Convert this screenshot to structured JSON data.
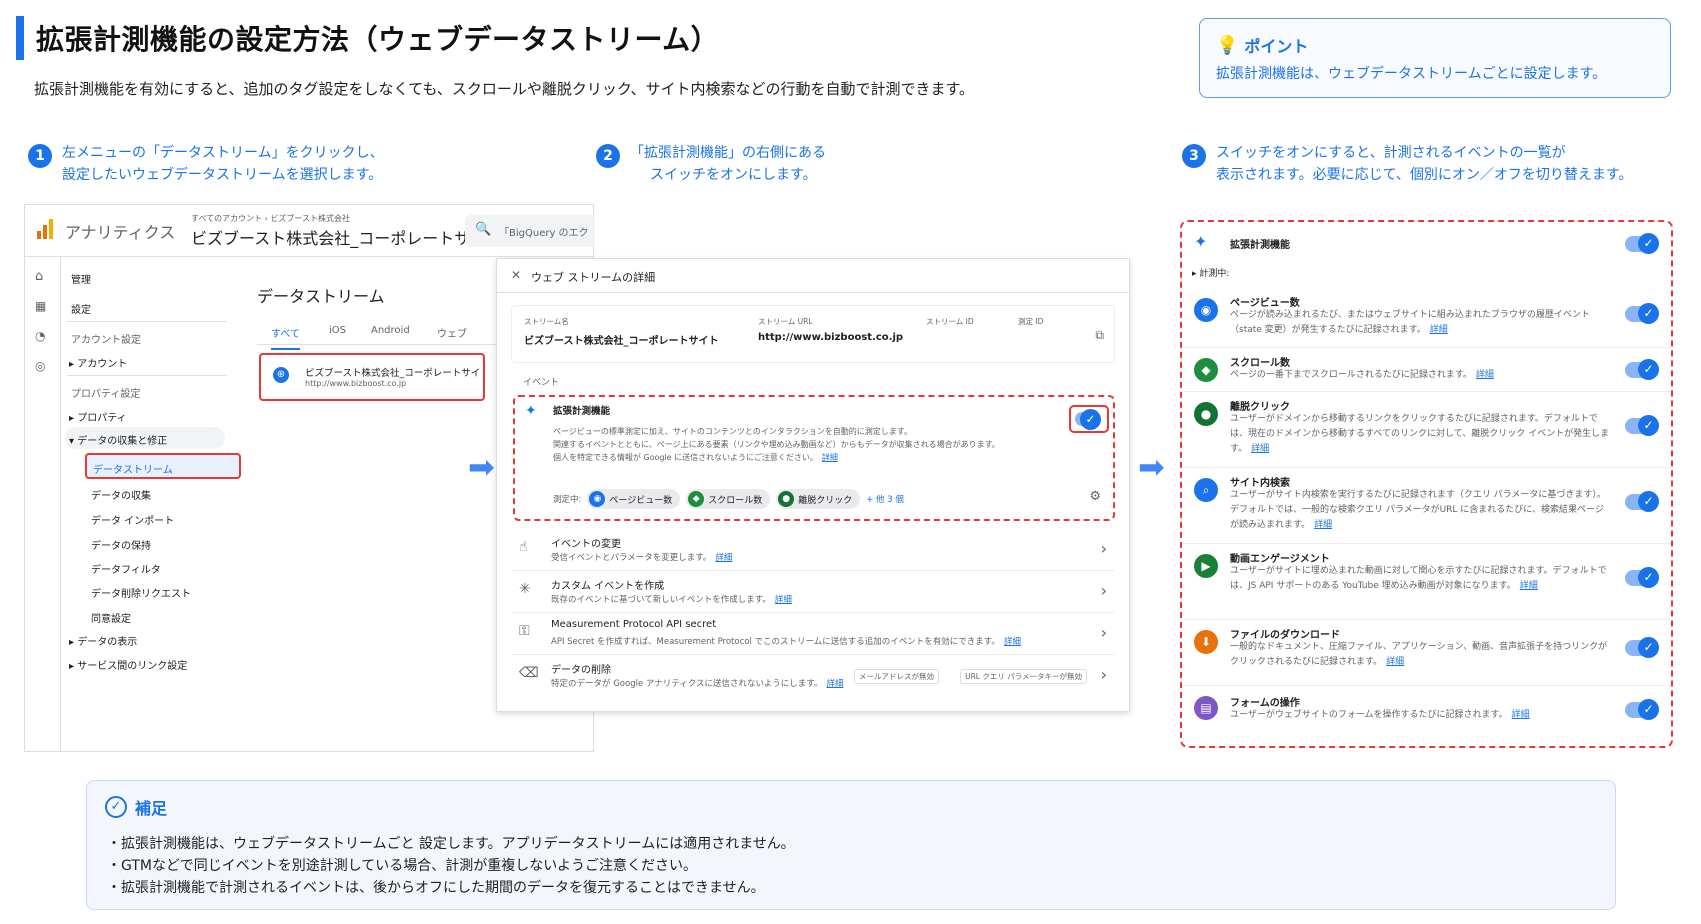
{
  "header": {
    "title": "拡張計測機能の設定方法（ウェブデータストリーム）",
    "subtitle": "拡張計測機能を有効にすると、追加のタグ設定をしなくても、スクロールや離脱クリック、サイト内検索などの行動を自動で計測できます。"
  },
  "point": {
    "label": "ポイント",
    "text": "拡張計測機能は、ウェブデータストリームごとに設定します。"
  },
  "steps": [
    {
      "num": "1",
      "line1": "左メニューの「データストリーム」をクリックし、",
      "line2": "設定したいウェブデータストリームを選択します。"
    },
    {
      "num": "2",
      "line1": "「拡張計測機能」の右側にある",
      "line2": "スイッチをオンにします。"
    },
    {
      "num": "3",
      "line1": "スイッチをオンにすると、計測されるイベントの一覧が",
      "line2": "表示されます。必要に応じて、個別にオン／オフを切り替えます。"
    }
  ],
  "ga": {
    "app_name": "アナリティクス",
    "breadcrumb": "すべてのアカウント › ビズブースト株式会社",
    "property": "ビズブースト株式会社_コーポレートサ",
    "search_placeholder": "「BigQuery のエク",
    "nav": {
      "admin": "管理",
      "settings": "設定",
      "account_settings": "アカウント設定",
      "account": "アカウント",
      "property_settings": "プロパティ設定",
      "property": "プロパティ",
      "data_collection": "データの収集と修正",
      "data_streams": "データストリーム",
      "data_collect": "データの収集",
      "data_import": "データ インポート",
      "data_retention": "データの保持",
      "data_filters": "データフィルタ",
      "data_deletion": "データ削除リクエスト",
      "consent": "同意設定",
      "data_display": "データの表示",
      "product_links": "サービス間のリンク設定"
    },
    "streams_title": "データストリーム",
    "tabs": [
      "すべて",
      "iOS",
      "Android",
      "ウェブ"
    ],
    "stream_name": "ビズブースト株式会社_コーポレートサイ",
    "stream_url": "http://www.bizboost.co.jp"
  },
  "detail": {
    "header": "ウェブ ストリームの詳細",
    "labels": {
      "name": "ストリーム名",
      "url": "ストリーム URL",
      "id": "ストリーム ID",
      "measure_id": "測定 ID"
    },
    "name": "ビズブースト株式会社_コーポレートサイト",
    "url": "http://www.bizboost.co.jp",
    "events_label": "イベント",
    "em_title": "拡張計測機能",
    "em_desc1": "ページビューの標準測定に加え、サイトのコンテンツとのインタラクションを自動的に測定します。",
    "em_desc2": "関連するイベントとともに、ページ上にある要素（リンクや埋め込み動画など）からもデータが収集される場合があります。",
    "em_desc3": "個人を特定できる情報が Google に送信されないようにご注意ください。",
    "detail_link": "詳細",
    "measuring": "測定中:",
    "chips": [
      "ページビュー数",
      "スクロール数",
      "離脱クリック"
    ],
    "more": "+ 他 3 個",
    "rows": [
      {
        "title": "イベントの変更",
        "desc": "受信イベントとパラメータを変更します。"
      },
      {
        "title": "カスタム イベントを作成",
        "desc": "既存のイベントに基づいて新しいイベントを作成します。"
      },
      {
        "title": "Measurement Protocol API secret",
        "desc": "API Secret を作成すれば、Measurement Protocol でこのストリームに送信する追加のイベントを有効にできます。"
      },
      {
        "title": "データの削除",
        "desc": "特定のデータが Google アナリティクスに送信されないようにします。"
      }
    ],
    "tags": [
      "メールアドレスが無効",
      "URL クエリ パラメータキーが無効"
    ]
  },
  "events": {
    "header": "拡張計測機能",
    "measuring": "▸ 計測中:",
    "link": "詳細",
    "items": [
      {
        "title": "ページビュー数",
        "desc": "ページが読み込まれるたび、またはウェブサイトに組み込まれたブラウザの履歴イベント（state 変更）が発生するたびに記録されます。",
        "icon": "eye-icon",
        "color": "#1a73e8"
      },
      {
        "title": "スクロール数",
        "desc": "ページの一番下までスクロールされるたびに記録されます。",
        "icon": "scroll-icon",
        "color": "#1e8e3e"
      },
      {
        "title": "離脱クリック",
        "desc": "ユーザーがドメインから移動するリンクをクリックするたびに記録されます。デフォルトでは、現在のドメインから移動するすべてのリンクに対して、離脱クリック イベントが発生します。",
        "icon": "click-icon",
        "color": "#137333"
      },
      {
        "title": "サイト内検索",
        "desc": "ユーザーがサイト内検索を実行するたびに記録されます（クエリ パラメータに基づきます）。デフォルトでは、一般的な検索クエリ パラメータがURL に含まれるたびに、検索結果ページが読み込まれます。",
        "icon": "search-icon",
        "color": "#1a73e8"
      },
      {
        "title": "動画エンゲージメント",
        "desc": "ユーザーがサイトに埋め込まれた動画に対して関心を示すたびに記録されます。デフォルトでは、JS API サポートのある YouTube 埋め込み動画が対象になります。",
        "icon": "play-icon",
        "color": "#188038"
      },
      {
        "title": "ファイルのダウンロード",
        "desc": "一般的なドキュメント、圧縮ファイル、アプリケーション、動画、音声拡張子を持つリンクがクリックされるたびに記録されます。",
        "icon": "download-icon",
        "color": "#e8710a"
      },
      {
        "title": "フォームの操作",
        "desc": "ユーザーがウェブサイトのフォームを操作するたびに記録されます。",
        "icon": "form-icon",
        "color": "#7e57c2"
      }
    ]
  },
  "supplement": {
    "label": "補足",
    "lines": [
      "・拡張計測機能は、ウェブデータストリームごと 設定します。アプリデータストリームには適用されません。",
      "・GTMなどで同じイベントを別途計測している場合、計測が重複しないようご注意ください。",
      "・拡張計測機能で計測されるイベントは、後からオフにした期間のデータを復元することはできません。"
    ]
  }
}
